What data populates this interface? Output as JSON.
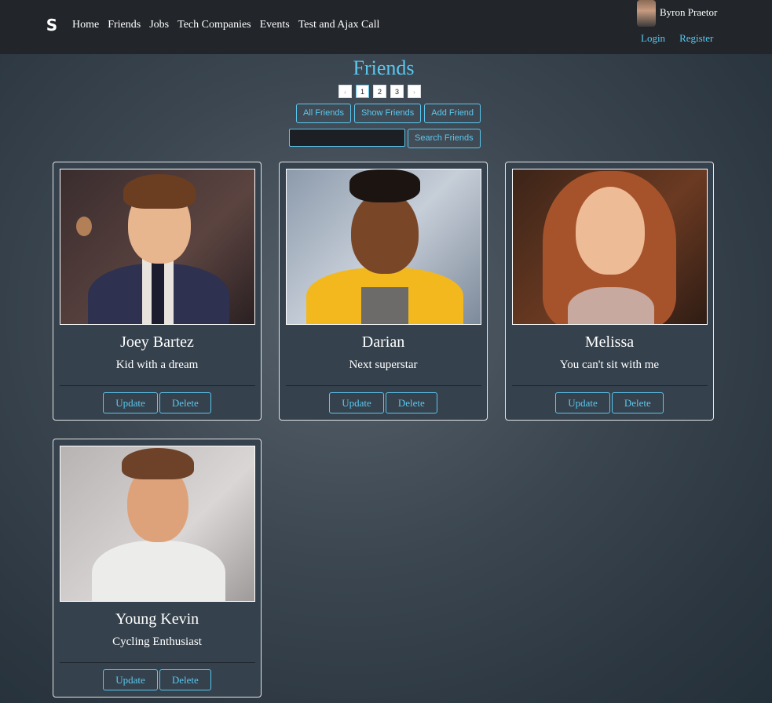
{
  "navbar": {
    "brand": "S",
    "links": [
      "Home",
      "Friends",
      "Jobs",
      "Tech Companies",
      "Events",
      "Test and Ajax Call"
    ],
    "user_name": "Byron Praetor",
    "login": "Login",
    "register": "Register"
  },
  "page": {
    "title": "Friends",
    "pagination": {
      "prev": "‹",
      "pages": [
        "1",
        "2",
        "3"
      ],
      "next": "›",
      "current": "1"
    },
    "buttons": {
      "all": "All Friends",
      "show": "Show Friends",
      "add": "Add Friend"
    },
    "search": {
      "value": "",
      "button": "Search Friends"
    }
  },
  "friends": [
    {
      "name": "Joey Bartez",
      "headline": "Kid with a dream",
      "update": "Update",
      "delete": "Delete"
    },
    {
      "name": "Darian",
      "headline": "Next superstar",
      "update": "Update",
      "delete": "Delete"
    },
    {
      "name": "Melissa",
      "headline": "You can't sit with me",
      "update": "Update",
      "delete": "Delete"
    },
    {
      "name": "Young Kevin",
      "headline": "Cycling Enthusiast",
      "update": "Update",
      "delete": "Delete"
    }
  ],
  "colors": {
    "accent": "#5bc8f0",
    "navbar": "#22262b",
    "card": "#35414c"
  }
}
